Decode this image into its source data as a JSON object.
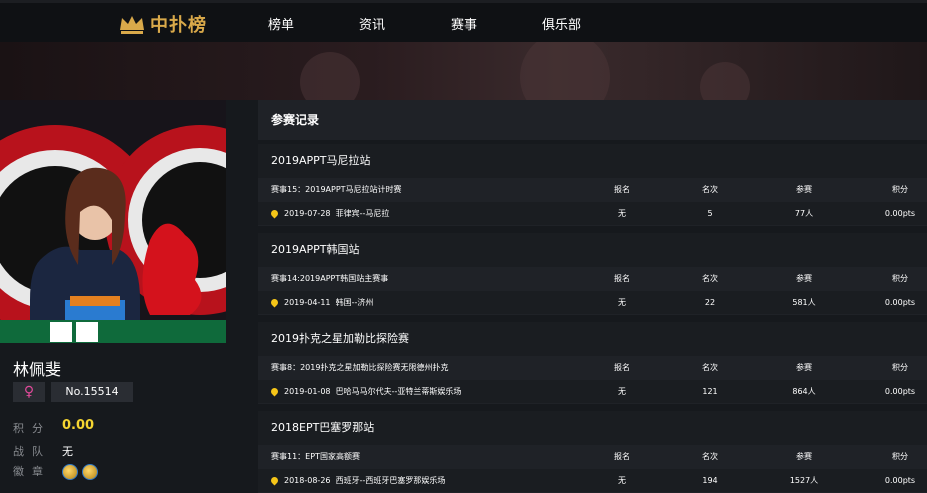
{
  "nav": {
    "logo_text": "中扑榜",
    "items": [
      {
        "label": "榜单"
      },
      {
        "label": "资讯"
      },
      {
        "label": "赛事"
      },
      {
        "label": "俱乐部"
      }
    ]
  },
  "profile": {
    "name": "林佩斐",
    "gender_symbol": "♀",
    "number": "No.15514",
    "stats": {
      "points_label": "积分",
      "points_value": "0.00",
      "team_label": "战队",
      "team_value": "无",
      "badge_label": "徽章"
    }
  },
  "records": {
    "header": "参赛记录",
    "columns": {
      "signup": "报名",
      "rank": "名次",
      "entrants": "参赛",
      "points": "积分"
    },
    "events": [
      {
        "title": "2019APPT马尼拉站",
        "event_name": "赛事15：2019APPT马尼拉站计时赛",
        "date": "2019-07-28",
        "location": "菲律宾--马尼拉",
        "signup": "无",
        "rank": "5",
        "entrants": "77人",
        "points": "0.00pts"
      },
      {
        "title": "2019APPT韩国站",
        "event_name": "赛事14:2019APPT韩国站主赛事",
        "date": "2019-04-11",
        "location": "韩国--济州",
        "signup": "无",
        "rank": "22",
        "entrants": "581人",
        "points": "0.00pts"
      },
      {
        "title": "2019扑克之星加勒比探险赛",
        "event_name": "赛事8：2019扑克之星加勒比探险赛无限德州扑克",
        "date": "2019-01-08",
        "location": "巴哈马马尔代夫--亚特兰蒂斯娱乐场",
        "signup": "无",
        "rank": "121",
        "entrants": "864人",
        "points": "0.00pts"
      },
      {
        "title": "2018EPT巴塞罗那站",
        "event_name": "赛事11：EPT国家高额赛",
        "date": "2018-08-26",
        "location": "西班牙--西班牙巴塞罗那娱乐场",
        "signup": "无",
        "rank": "194",
        "entrants": "1527人",
        "points": "0.00pts"
      }
    ]
  }
}
